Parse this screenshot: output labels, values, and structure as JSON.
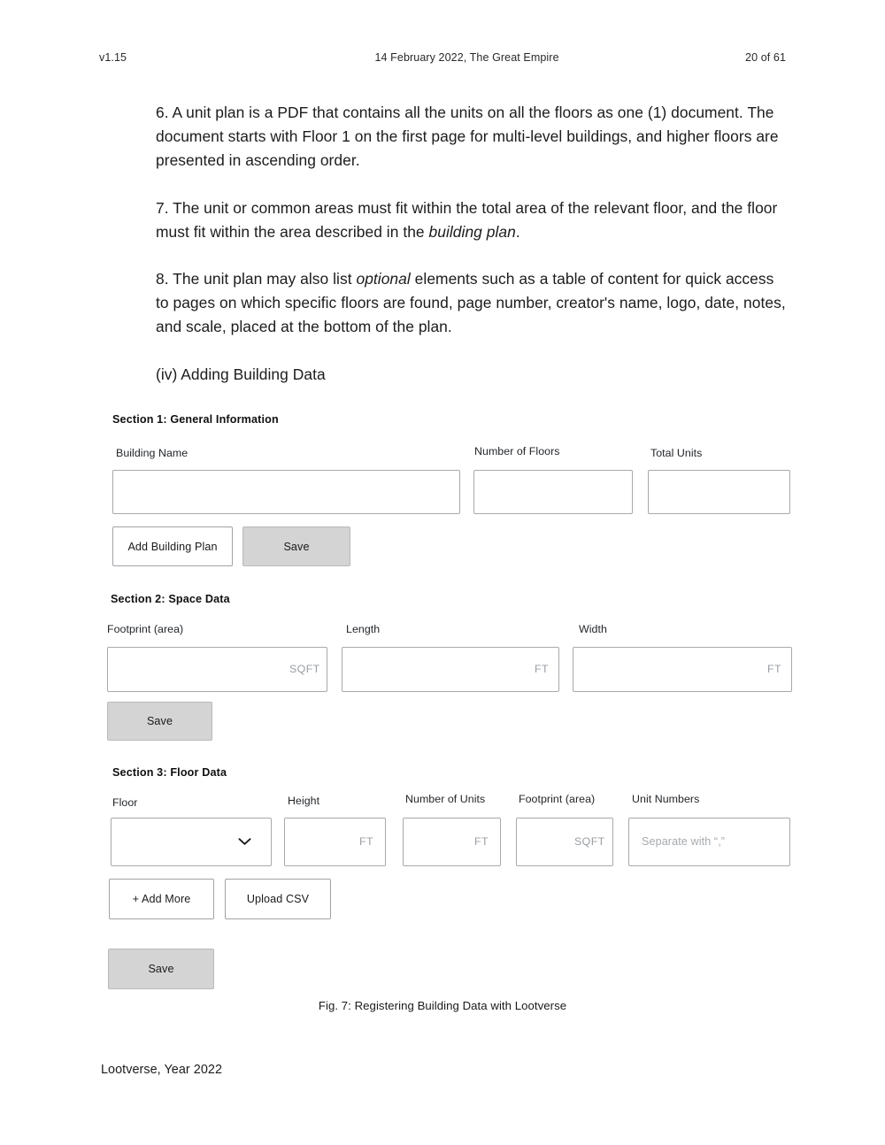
{
  "header": {
    "version": "v1.15",
    "center": "14 February 2022, The Great Empire",
    "page_indicator": "20 of 61"
  },
  "body": {
    "paragraph_6": "6. A unit plan is a PDF that contains all the units on all the floors as one (1) document. The document starts with Floor 1 on the first page for multi-level buildings, and higher floors are presented in ascending order.",
    "paragraph_7_part1": "7. The unit or common areas must fit within the total area of the relevant floor, and the floor must fit within the area described in the ",
    "paragraph_7_italic": "building plan",
    "paragraph_7_part2": ".",
    "paragraph_8_part1": "8. The unit plan may also list ",
    "paragraph_8_italic": "optional",
    "paragraph_8_part2": " elements such as a table of content for quick access to pages on which specific floors are found, page number, creator's name, logo, date, notes, and scale, placed at the bottom of the plan.",
    "sub_heading": "(iv) Adding Building Data"
  },
  "figure": {
    "caption": "Fig. 7: Registering Building Data with Lootverse",
    "section1": {
      "title": "Section 1: General Information",
      "fields": [
        {
          "label": "Building Name",
          "value": "",
          "placeholder": "",
          "suffix": ""
        },
        {
          "label": "Number of Floors",
          "value": "",
          "placeholder": "",
          "suffix": ""
        },
        {
          "label": "Total Units",
          "value": "",
          "placeholder": "",
          "suffix": ""
        }
      ],
      "buttons": [
        {
          "label": "Add Building Plan",
          "style": "outline"
        },
        {
          "label": "Save",
          "style": "filled"
        }
      ]
    },
    "section2": {
      "title": "Section 2: Space Data",
      "fields": [
        {
          "label": "Footprint (area)",
          "value": "",
          "placeholder": "",
          "suffix": "SQFT"
        },
        {
          "label": "Length",
          "value": "",
          "placeholder": "",
          "suffix": "FT"
        },
        {
          "label": "Width",
          "value": "",
          "placeholder": "",
          "suffix": "FT"
        }
      ],
      "buttons": [
        {
          "label": "Save",
          "style": "filled"
        }
      ]
    },
    "section3": {
      "title": "Section 3: Floor Data",
      "fields": [
        {
          "label": "Floor",
          "value": "",
          "placeholder": "",
          "suffix": "",
          "control": "select",
          "icon": "chevron-down-icon"
        },
        {
          "label": "Height",
          "value": "",
          "placeholder": "",
          "suffix": "FT"
        },
        {
          "label": "Number of Units",
          "value": "",
          "placeholder": "",
          "suffix": "FT"
        },
        {
          "label": "Footprint (area)",
          "value": "",
          "placeholder": "",
          "suffix": "SQFT"
        },
        {
          "label": "Unit Numbers",
          "value": "",
          "placeholder": "Separate with “,”",
          "suffix": ""
        }
      ],
      "buttons": [
        {
          "label": "+ Add More",
          "style": "outline"
        },
        {
          "label": "Upload CSV",
          "style": "outline"
        },
        {
          "label": "Save",
          "style": "filled"
        }
      ]
    }
  },
  "footer": {
    "text": "Lootverse, Year 2022"
  },
  "colors": {
    "page_background": "#ffffff",
    "text": "#1c1c1c",
    "field_border": "#a7a9ac",
    "placeholder": "#a6aaae",
    "button_filled": "#d4d4d4",
    "button_filled_border": "#b9b9b9",
    "button_outline_border": "#9fa2a6"
  }
}
